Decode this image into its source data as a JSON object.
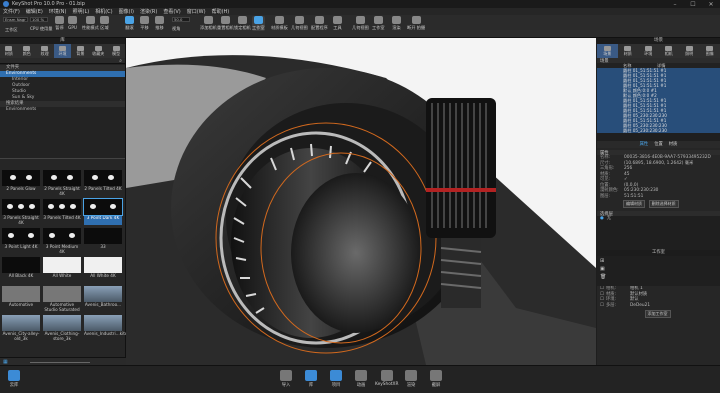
{
  "app": {
    "title": "KeyShot Pro 10.0 Pro - 01.bip"
  },
  "menu": [
    "文件(F)",
    "编辑(E)",
    "环境(N)",
    "照明(L)",
    "相机(C)",
    "图像(I)",
    "渲染(R)",
    "查看(V)",
    "窗口(W)",
    "帮助(H)"
  ],
  "ribbon": {
    "selects": [
      "Ensm Nagr",
      "100 %"
    ],
    "left_label": "工作区",
    "buttons": [
      "CPU 使用量",
      "暂停",
      "GPU",
      "性能模式",
      "区域",
      "翻滚",
      "平移",
      "推移",
      "视角",
      "添加相机",
      "重置相机",
      "锁定相机",
      "工作室",
      "材质模板",
      "几何视图",
      "配置程序",
      "工作室",
      "渲染",
      "KeyShot XR",
      "配置程序",
      "动画向导",
      "渲染",
      "脚本",
      "工具",
      "渲染",
      "脚本",
      "几何视图"
    ]
  },
  "ribbon_labels": {
    "b1": "CPU 使用量",
    "b2": "暂停",
    "b3": "GPU",
    "b4": "性能模式",
    "b5": "区域",
    "b6": "翻滚",
    "b7": "平移",
    "b8": "推移",
    "b9": "视角",
    "b10": "添加相机",
    "b11": "重置相机",
    "b12": "锁定相机",
    "b13": "工作室",
    "b14": "材质模板",
    "b15": "几何视图",
    "b16": "配置程序",
    "b17": "工具",
    "b18": "几何视图",
    "b19": "工作室",
    "b20": "渲染",
    "b21": "断开\n拍摄",
    "fov": "50.0"
  },
  "left": {
    "panel_title": "库",
    "tabs": [
      "材质",
      "颜色",
      "纹理",
      "环境",
      "背景",
      "收藏夹",
      "模型"
    ],
    "tree_header": "文件夹",
    "tree": [
      "Environments",
      "Interior",
      "Outdoor",
      "Studio",
      "Sun & Sky"
    ],
    "tree2_header": "搜索结果",
    "tree2": [
      "Environments"
    ],
    "thumbs": [
      {
        "label": "2 Panels Glow"
      },
      {
        "label": "2 Panels Straight 4K"
      },
      {
        "label": "2 Panels Tilted 4K"
      },
      {
        "label": "3 Panels Straight 4K"
      },
      {
        "label": "3 Panels Tilted 4K"
      },
      {
        "label": "3 Point Dark 4K"
      },
      {
        "label": "3 Point Light 4K"
      },
      {
        "label": "3 Point Medium 4K"
      },
      {
        "label": "33"
      },
      {
        "label": "All Black 4K"
      },
      {
        "label": "All White"
      },
      {
        "label": "All White 4K"
      },
      {
        "label": "Automotive"
      },
      {
        "label": "Automotive Studio Saturated"
      },
      {
        "label": "Avenis_Bathroo..."
      },
      {
        "label": "Avenis_City-alley-old_3k"
      },
      {
        "label": "Avenis_Clothing-store_3k"
      },
      {
        "label": "Avenis_Industri...kitchen_3k"
      }
    ]
  },
  "right": {
    "panel_title": "场景",
    "tabs": [
      "场景",
      "材质",
      "环境",
      "相机",
      "照明",
      "图像"
    ],
    "section_title": "场景",
    "tree_cols": [
      "名称",
      "详情"
    ],
    "scene_rows": [
      "圆柱 01_51:51:51 #1",
      "圆柱 01_51:51:51 #1",
      "圆柱 01_51:51:51 #1",
      "圆柱 01_51:51:51 #1",
      "默认 颜色:0:0 #1",
      "默认 颜色:0:0 #2",
      "圆柱 01_51:51:51 #1",
      "圆柱 01_51:51:51 #1",
      "圆柱 01_51:51:51 #1",
      "圆柱 05_230:230:230",
      "圆柱 01_51:51:51 #1",
      "圆柱 05_230:230:230",
      "圆柱 05_230:230:230"
    ],
    "sub_tabs": [
      "属性",
      "位置",
      "材质"
    ],
    "info_title": "属性",
    "info": [
      {
        "k": "名称:",
        "v": "00035-3816-4E0B-9AA7-57933495232D"
      },
      {
        "k": "尺寸:",
        "v": "(10.6895, 18.6900, 1.2642) 毫米"
      },
      {
        "k": "三角形:",
        "v": "256"
      },
      {
        "k": "材质:",
        "v": "45"
      },
      {
        "k": "可见:",
        "v": "✓"
      },
      {
        "k": "位置:",
        "v": "(0,0,0)"
      },
      {
        "k": "漫射颜色:",
        "v": "05:230:230:230"
      },
      {
        "k": "图层:",
        "v": "51:51:51"
      }
    ],
    "info_buttons": [
      "编辑材质",
      "删除选择材质"
    ],
    "layers_title": "选择层",
    "layer_items": [
      "无"
    ],
    "workspace_title": "工作室",
    "ws_items": [
      "相机:",
      "材质:",
      "环境:",
      "多层:"
    ],
    "ws_values": [
      "相机 1",
      "默认材质",
      "默认",
      "DeDeu21"
    ],
    "ws_button": "添加工作室"
  },
  "bottom": {
    "left_label": "云库",
    "buttons": [
      "导入",
      "库",
      "项目",
      "动画",
      "KeyShotXR",
      "渲染",
      "截屏"
    ]
  }
}
